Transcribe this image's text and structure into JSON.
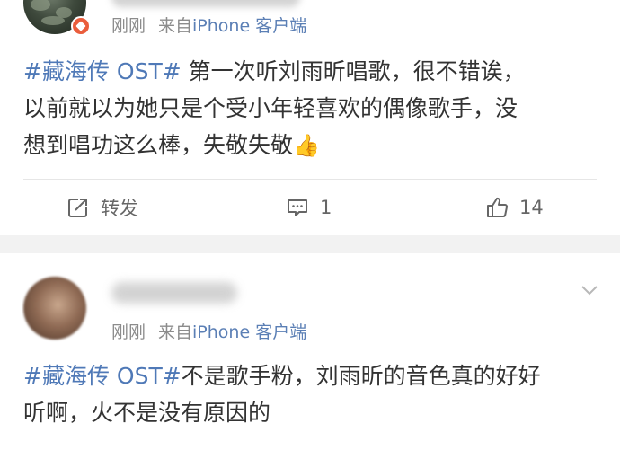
{
  "posts": [
    {
      "time": "刚刚",
      "source_prefix": "来自",
      "source_device": "iPhone 客户端",
      "hashtag": "#藏海传 OST#",
      "text_line1": " 第一次听刘雨昕唱歌，很不错诶，",
      "text_line2": "以前就以为她只是个受小年轻喜欢的偶像歌手，没",
      "text_line3": "想到唱功这么棒，失敬失敬",
      "emoji": "👍",
      "actions": {
        "repost_label": "转发",
        "comment_count": "1",
        "like_count": "14"
      }
    },
    {
      "time": "刚刚",
      "source_prefix": "来自",
      "source_device": "iPhone 客户端",
      "hashtag": "#藏海传 OST#",
      "text_line1": "不是歌手粉，刘雨昕的音色真的好好",
      "text_line2": "听啊，火不是没有原因的"
    }
  ],
  "colors": {
    "hashtag": "#4f79b7",
    "device": "#5b7fb5",
    "meta": "#8c8c8c",
    "badge": "#ea5d3c"
  },
  "icons": {
    "repost": "repost-icon",
    "comment": "comment-icon",
    "like": "thumbs-up-icon",
    "menu": "chevron-down-icon",
    "verified": "verified-badge-icon"
  }
}
